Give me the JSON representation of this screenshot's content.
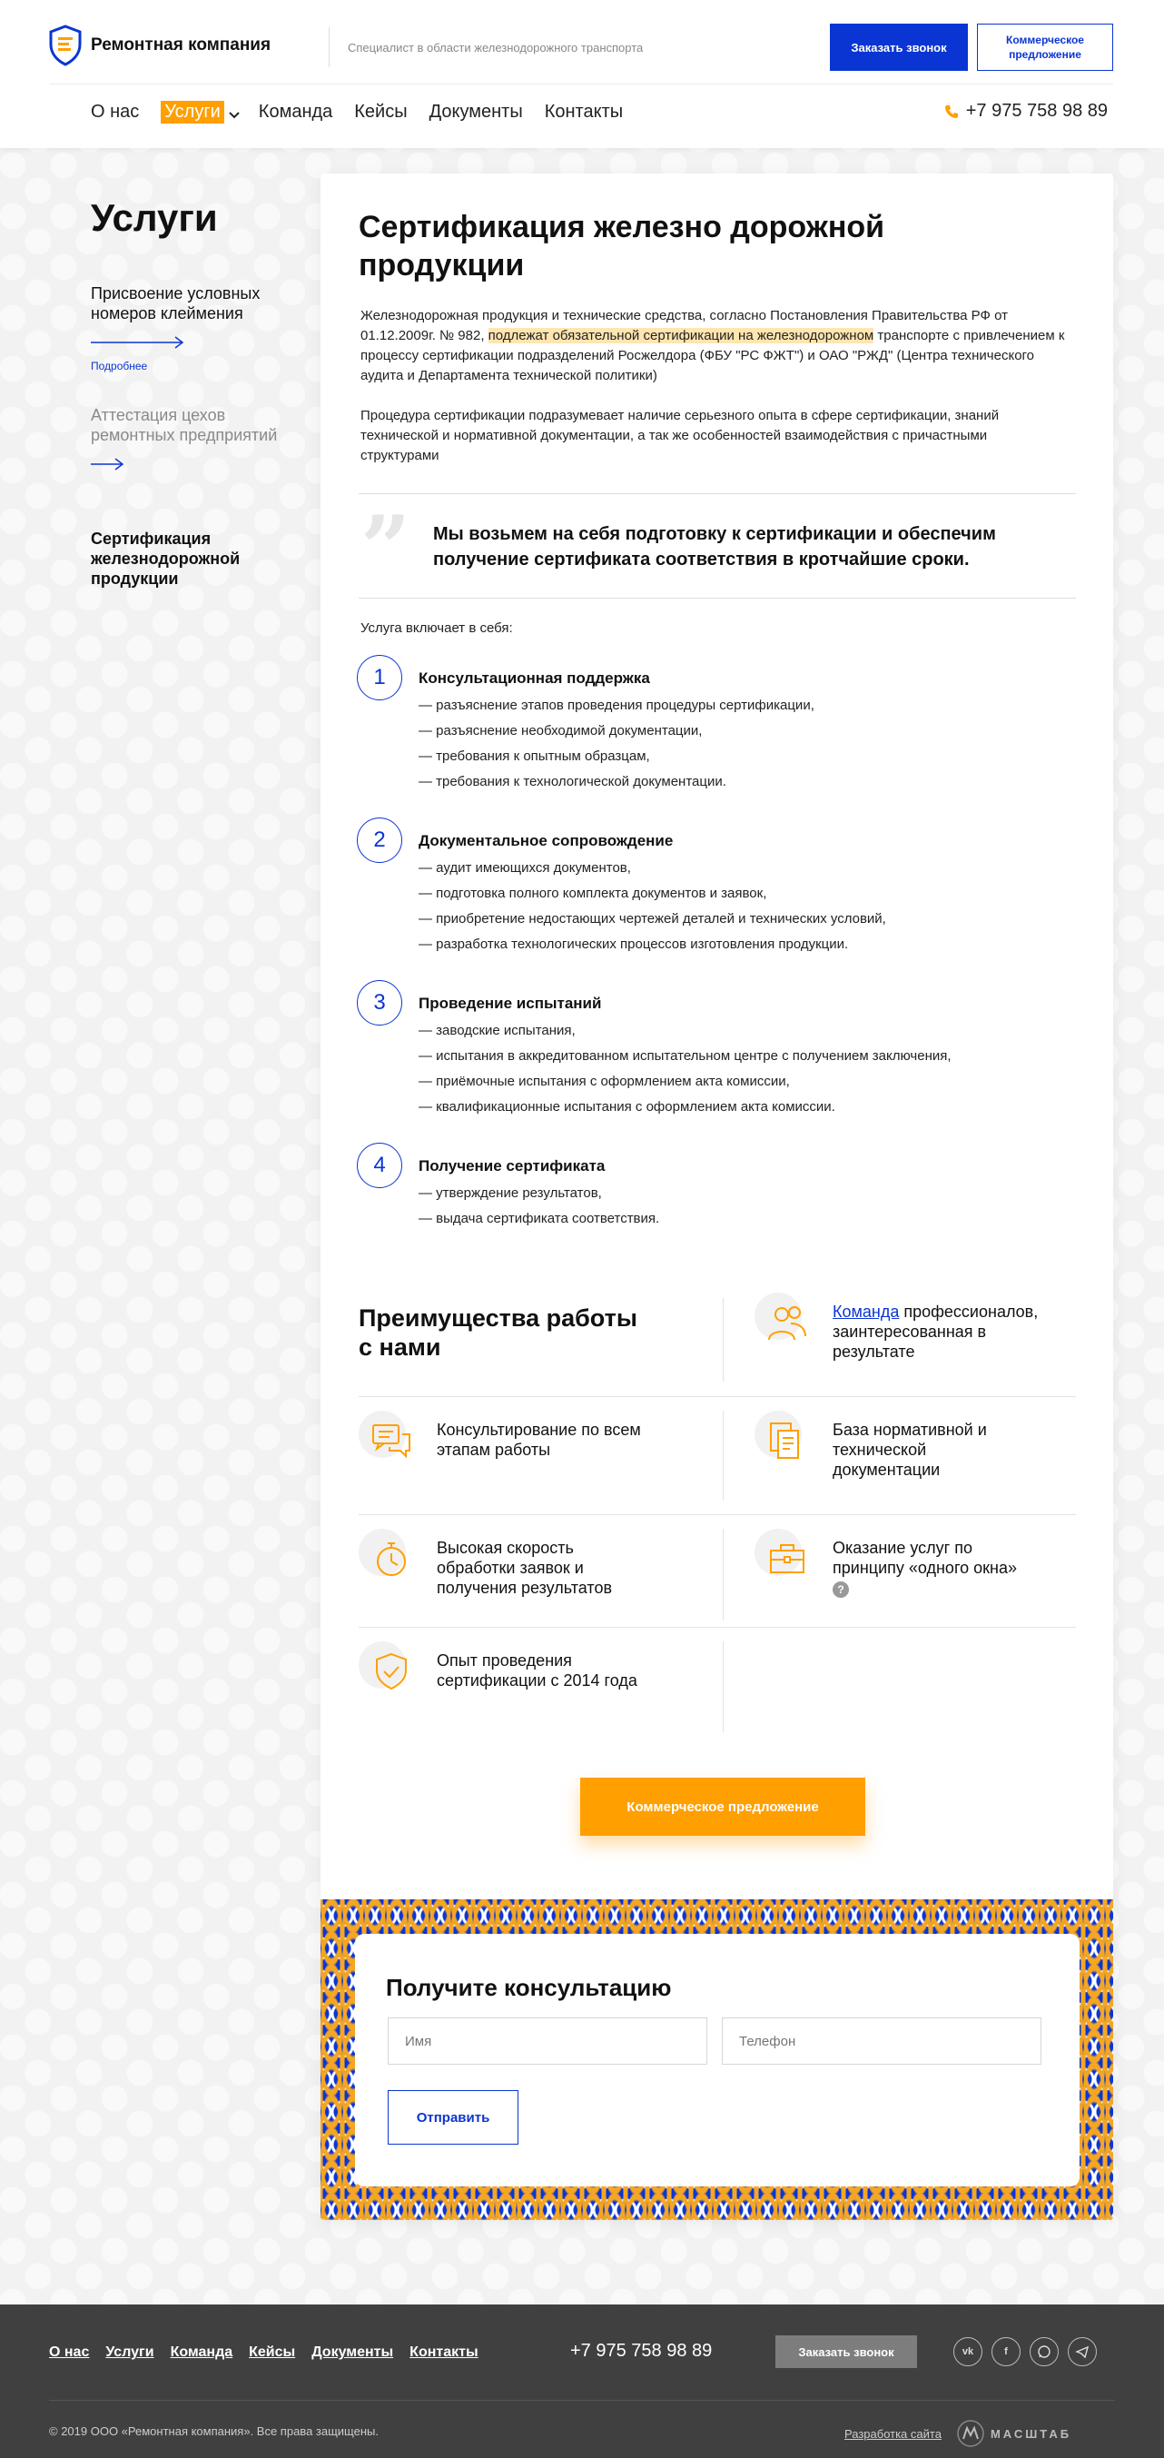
{
  "header": {
    "logo_text": "Ремонтная компания",
    "tagline": "Специалист в области железнодорожного транспорта",
    "call_button": "Заказать звонок",
    "offer_button": "Коммерческое предложение",
    "nav": [
      "О нас",
      "Услуги",
      "Команда",
      "Кейсы",
      "Документы",
      "Контакты"
    ],
    "phone": "+7 975 758 98 89"
  },
  "sidebar": {
    "title": "Услуги",
    "items": [
      {
        "label": "Присвоение условных номеров клеймения",
        "more": "Подробнее"
      },
      {
        "label": "Аттестация цехов ремонтных предприятий"
      },
      {
        "label": "Сертификация железнодорожной продукции"
      }
    ]
  },
  "main": {
    "title": "Сертификация железно дорожной продукции",
    "intro_before": "Железнодорожная продукция и технические средства, согласно Постановления Правительства РФ от 01.12.2009г. № 982, ",
    "intro_highlight": "подлежат обязательной сертификации на железнодорожном",
    "intro_after": " транспорте с привлечением к процессу сертификации подразделений Росжелдора (ФБУ \"РС ФЖТ\") и ОАО \"РЖД\" (Центра технического аудита и Департамента технической политики)",
    "intro2": "Процедура сертификации подразумевает наличие серьезного опыта в сфере сертификации, знаний технической и нормативной документации, а так же особенностей взаимодействия с причастными структурами",
    "quote": "Мы возьмем на себя подготовку к сертификации и обеспечим получение сертификата соответствия в кротчайшие сроки.",
    "includes_label": "Услуга включает в себя:",
    "steps": [
      {
        "num": "1",
        "title": "Консультационная поддержка",
        "items": [
          "разъяснение этапов проведения процедуры сертификации,",
          "разъяснение необходимой документации,",
          "требования к опытным образцам,",
          "требования к технологической документации."
        ]
      },
      {
        "num": "2",
        "title": "Документальное сопровождение",
        "items": [
          "аудит имеющихся документов,",
          "подготовка полного комплекта документов и заявок,",
          "приобретение недостающих чертежей деталей и технических условий,",
          "разработка технологических процессов изготовления продукции."
        ]
      },
      {
        "num": "3",
        "title": "Проведение испытаний",
        "items": [
          "заводские испытания,",
          "испытания в аккредитованном испытательном центре с получением заключения,",
          "приёмочные испытания с оформлением акта комиссии,",
          "квалификационные испытания с оформлением акта комиссии."
        ]
      },
      {
        "num": "4",
        "title": "Получение сертификата",
        "items": [
          "утверждение результатов,",
          "выдача сертификата соответствия."
        ]
      }
    ],
    "advantages_title": "Преимущества работы с нами",
    "advantages": {
      "team_link": "Команда",
      "team_rest": " профессионалов, заинтересованная в результате",
      "consult": "Консультирование по всем этапам работы",
      "base": "База нормативной и технической документации",
      "speed": "Высокая скорость обработки заявок и получения результатов",
      "window": "Оказание услуг по принципу «одного окна»",
      "window_badge": "?",
      "experience": "Опыт проведения сертификации с 2014 года"
    },
    "offer_button": "Коммерческое предложение"
  },
  "consult": {
    "title": "Получите консультацию",
    "name_placeholder": "Имя",
    "phone_placeholder": "Телефон",
    "submit": "Отправить"
  },
  "footer": {
    "nav": [
      "О нас",
      "Услуги",
      "Команда",
      "Кейсы",
      "Документы",
      "Контакты"
    ],
    "phone": "+7 975 758 98 89",
    "call_button": "Заказать звонок",
    "socials": [
      "vk",
      "facebook",
      "whatsapp",
      "telegram"
    ],
    "copyright": "© 2019  ООО «Ремонтная компания».  Все права защищены.",
    "dev_label": "Разработка сайта",
    "dev_logo": "МАСШТАБ"
  },
  "colors": {
    "brand_blue": "#0b35d3",
    "accent_orange": "#ff9f00",
    "footer_bg": "#404040"
  }
}
